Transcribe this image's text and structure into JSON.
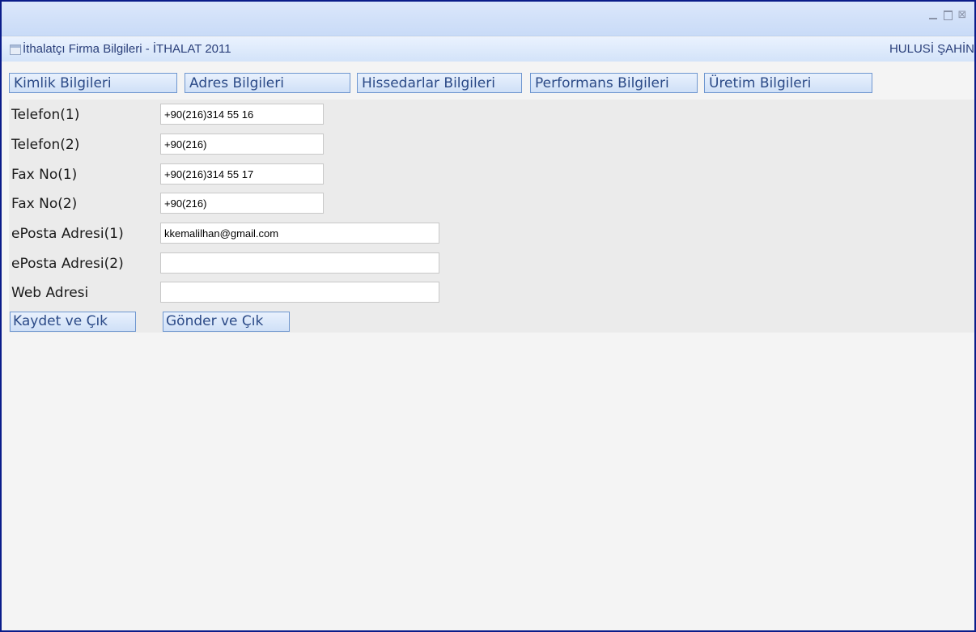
{
  "window": {
    "controls": [
      "minimize-icon",
      "maximize-icon",
      "close-icon"
    ]
  },
  "header": {
    "title": "İthalatçı Firma Bilgileri - İTHALAT 2011",
    "user": "HULUSİ ŞAHİN"
  },
  "tabs": [
    {
      "label": "Kimlik Bilgileri"
    },
    {
      "label": "Adres Bilgileri"
    },
    {
      "label": "Hissedarlar Bilgileri"
    },
    {
      "label": "Performans Bilgileri"
    },
    {
      "label": "Üretim Bilgileri"
    }
  ],
  "form": {
    "fields": [
      {
        "label": "Telefon(1)",
        "value": "+90(216)314 55 16"
      },
      {
        "label": "Telefon(2)",
        "value": "+90(216)"
      },
      {
        "label": "Fax No(1)",
        "value": "+90(216)314 55 17"
      },
      {
        "label": "Fax No(2)",
        "value": "+90(216)"
      },
      {
        "label": "ePosta Adresi(1)",
        "value": "kkemalilhan@gmail.com"
      },
      {
        "label": "ePosta Adresi(2)",
        "value": ""
      },
      {
        "label": "Web Adresi",
        "value": ""
      }
    ],
    "save_label": "Kaydet ve Çık",
    "send_label": "Gönder ve Çık"
  },
  "colors": {
    "window_border": "#0a1c8a",
    "tab_border": "#6e96cf",
    "tab_text": "#2b4a87",
    "form_background": "#ebebeb"
  }
}
